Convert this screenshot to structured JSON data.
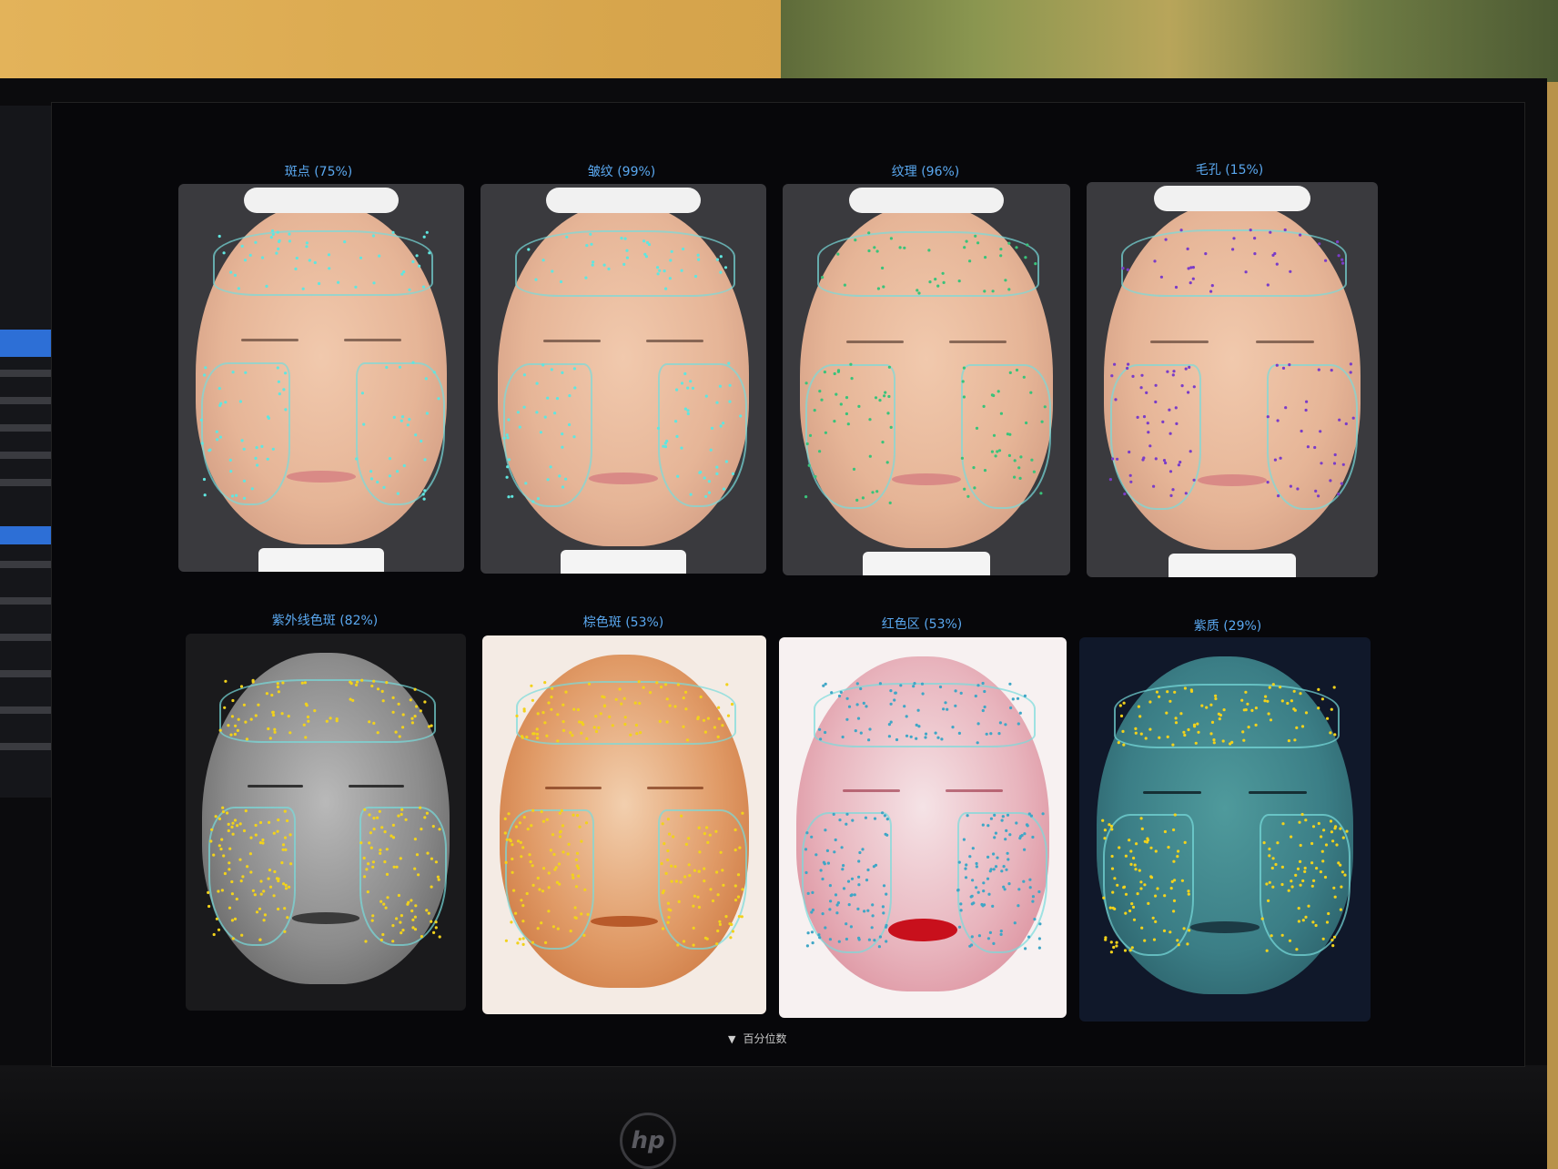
{
  "brand": {
    "logo_text": "hp"
  },
  "tiles": [
    {
      "label": "斑点 (75%)",
      "style": "natural",
      "dot_color": "#5fe6e0"
    },
    {
      "label": "皱纹 (99%)",
      "style": "natural",
      "dot_color": "#5fe6e0"
    },
    {
      "label": "纹理 (96%)",
      "style": "natural",
      "dot_color": "#39c37a"
    },
    {
      "label": "毛孔 (15%)",
      "style": "natural",
      "dot_color": "#7a3cc8"
    },
    {
      "label": "紫外线色斑 (82%)",
      "style": "uv-gray",
      "dot_color": "#f2d21b"
    },
    {
      "label": "棕色斑 (53%)",
      "style": "brown",
      "dot_color": "#f2d21b"
    },
    {
      "label": "红色区 (53%)",
      "style": "red",
      "dot_color": "#3fa6c6"
    },
    {
      "label": "紫质 (29%)",
      "style": "teal",
      "dot_color": "#f2d21b"
    }
  ],
  "footer": {
    "label": "百分位数",
    "toggle_icon": "triangle-down-icon"
  },
  "colors": {
    "label_blue": "#5aa8f0",
    "zone_outline": "#78dcdc"
  }
}
